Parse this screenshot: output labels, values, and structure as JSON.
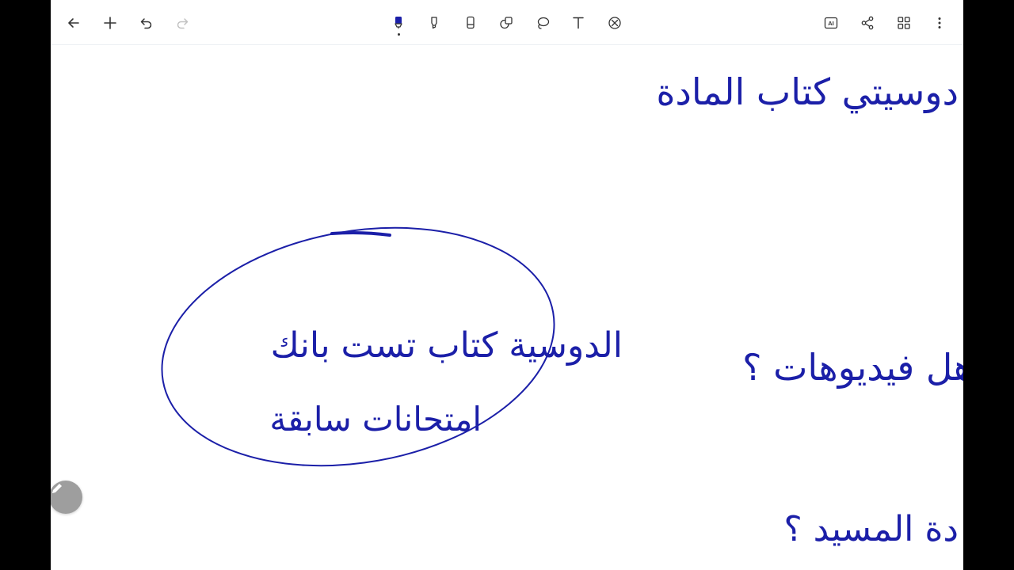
{
  "toolbar": {
    "left": [
      {
        "name": "back-arrow-icon"
      },
      {
        "name": "add-icon"
      },
      {
        "name": "undo-icon"
      },
      {
        "name": "redo-icon"
      }
    ],
    "tools": [
      {
        "name": "pen-tool-icon",
        "active": true
      },
      {
        "name": "highlighter-tool-icon"
      },
      {
        "name": "eraser-tool-icon"
      },
      {
        "name": "shapes-tool-icon"
      },
      {
        "name": "lasso-tool-icon"
      },
      {
        "name": "text-tool-icon"
      },
      {
        "name": "ruler-tool-icon"
      }
    ],
    "right": [
      {
        "name": "ai-icon",
        "label": "AI"
      },
      {
        "name": "share-icon"
      },
      {
        "name": "grid-view-icon"
      },
      {
        "name": "more-options-icon"
      }
    ]
  },
  "ink": {
    "color": "#1b1fa8",
    "lines": [
      {
        "id": "line1",
        "text": "دوسيتي كتاب المادة"
      },
      {
        "id": "line2",
        "text": "الدوسية كتاب تست بانك"
      },
      {
        "id": "line3",
        "text": "امتحانات سابقة"
      },
      {
        "id": "line4",
        "text": "هل فيديوهات ؟"
      },
      {
        "id": "line5",
        "text": "دة المسيد ؟"
      }
    ]
  },
  "fab": {
    "name": "edit-pencil-icon"
  }
}
